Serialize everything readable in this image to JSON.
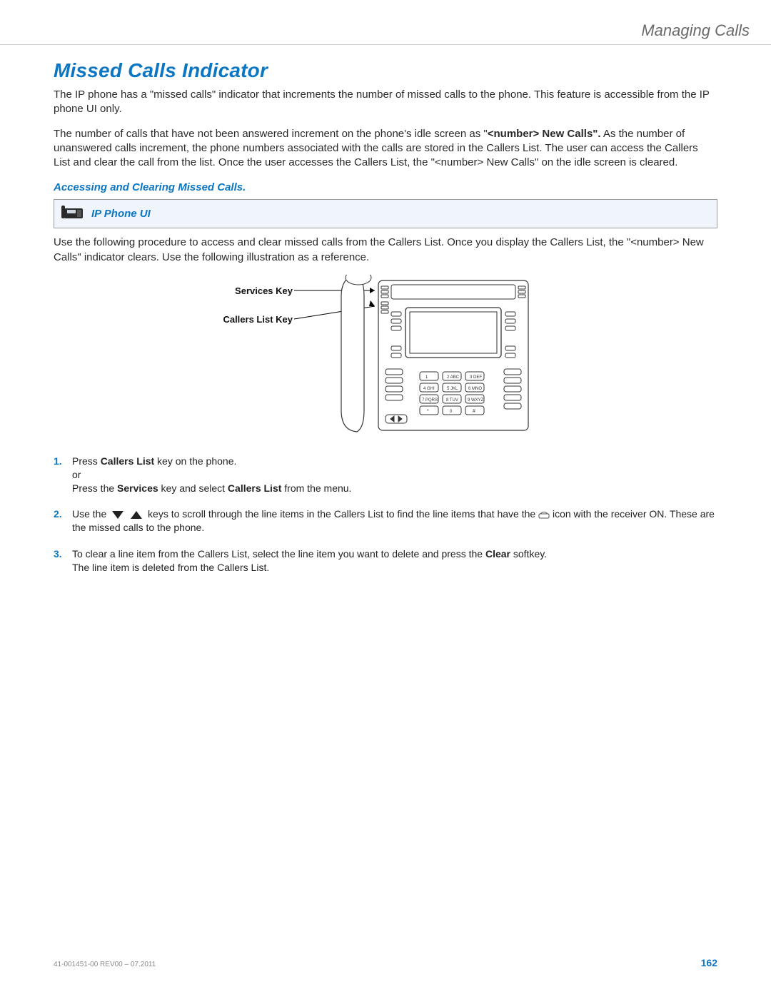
{
  "header": {
    "section": "Managing Calls"
  },
  "title": "Missed Calls Indicator",
  "intro_paragraphs": [
    "The IP phone has a \"missed calls\" indicator that increments the number of missed calls to the phone. This feature is accessible from the IP phone UI only.",
    "The number of calls that have not been answered increment on the phone's idle screen as \"<number> New Calls\". As the number of unanswered calls increment, the phone numbers associated with the calls are stored in the Callers List. The user can access the Callers List and clear the call from the list. Once the user accesses the Callers List, the \"<number> New Calls\" on the idle screen is cleared."
  ],
  "subhead": "Accessing and Clearing Missed Calls.",
  "callout": {
    "icon": "phone-icon",
    "label": "IP Phone UI"
  },
  "preamble": "Use the following procedure to access and clear missed calls from the Callers List. Once you display the Callers List, the \"<number> New Calls\" indicator clears. Use the following illustration as a reference.",
  "illustration": {
    "label_services": "Services Key",
    "label_callers": "Callers List Key"
  },
  "steps": [
    {
      "num": "1.",
      "lines": [
        {
          "segments": [
            {
              "t": "Press "
            },
            {
              "t": "Callers List",
              "b": true
            },
            {
              "t": " key on the phone."
            }
          ]
        },
        {
          "segments": [
            {
              "t": "or"
            }
          ]
        },
        {
          "segments": [
            {
              "t": "Press the "
            },
            {
              "t": "Services",
              "b": true
            },
            {
              "t": " key and select "
            },
            {
              "t": "Callers List",
              "b": true
            },
            {
              "t": " from the menu."
            }
          ]
        }
      ]
    },
    {
      "num": "2.",
      "lines": [
        {
          "segments": [
            {
              "t": "Use the "
            },
            {
              "icon": "nav-triangles"
            },
            {
              "t": " keys to scroll through the line items in the Callers List to find the line items that have the "
            },
            {
              "icon": "handset"
            },
            {
              "t": " icon with the receiver ON. These are the missed calls to the phone."
            }
          ]
        }
      ]
    },
    {
      "num": "3.",
      "lines": [
        {
          "segments": [
            {
              "t": "To clear a line item from the Callers List, select the line item you want to delete and press the "
            },
            {
              "t": "Clear",
              "b": true
            },
            {
              "t": " softkey."
            }
          ]
        },
        {
          "segments": [
            {
              "t": "The line item is deleted from the Callers List."
            }
          ]
        }
      ]
    }
  ],
  "footer": {
    "doc": "41-001451-00 REV00 – 07.2011",
    "page": "162"
  }
}
